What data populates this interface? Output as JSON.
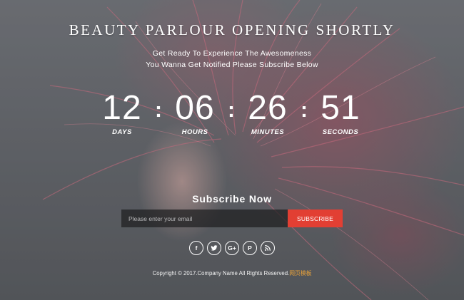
{
  "header": {
    "title": "BEAUTY PARLOUR OPENING SHORTLY",
    "subtitle_line1": "Get Ready To Experience The Awesomeness",
    "subtitle_line2": "You Wanna Get Notified Please Subscribe Below"
  },
  "countdown": {
    "separator": ":",
    "units": [
      {
        "value": "12",
        "label": "DAYS"
      },
      {
        "value": "06",
        "label": "HOURS"
      },
      {
        "value": "26",
        "label": "MINUTES"
      },
      {
        "value": "51",
        "label": "SECONDS"
      }
    ]
  },
  "subscribe": {
    "heading": "Subscribe Now",
    "email_placeholder": "Please enter your email",
    "button_label": "SUBSCRIBE",
    "button_color": "#e23f33"
  },
  "social": [
    {
      "icon": "facebook-icon",
      "glyph": "f"
    },
    {
      "icon": "twitter-icon",
      "glyph": "twitter"
    },
    {
      "icon": "google-plus-icon",
      "glyph": "G+"
    },
    {
      "icon": "pinterest-icon",
      "glyph": "P"
    },
    {
      "icon": "rss-icon",
      "glyph": "rss"
    }
  ],
  "footer": {
    "copyright": "Copyright © 2017.Company Name All Rights Reserved.",
    "link_text": "网页模板",
    "link_color": "#e8a23a"
  }
}
